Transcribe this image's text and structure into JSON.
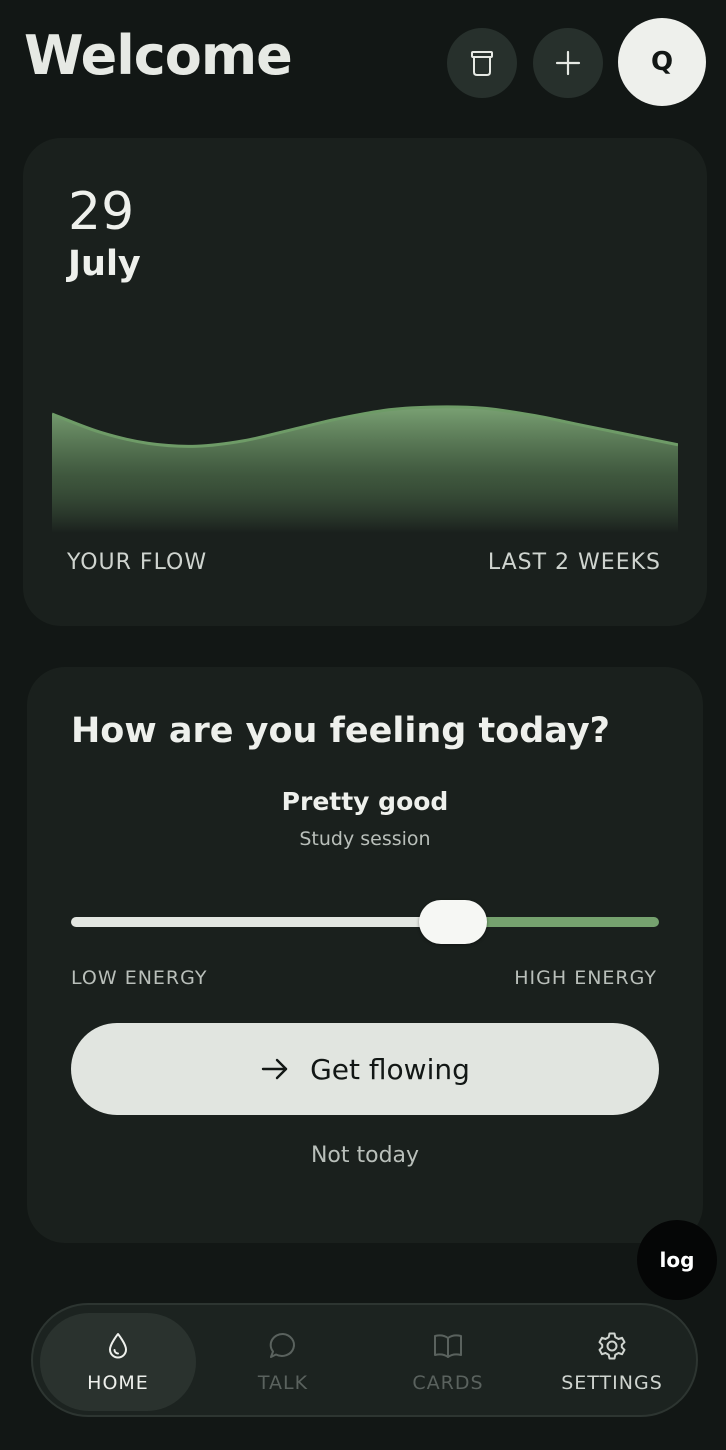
{
  "header": {
    "title": "Welcome",
    "avatar_initial": "Q",
    "icons": [
      "jar-icon",
      "plus-icon"
    ]
  },
  "flow_card": {
    "day": "29",
    "month": "July",
    "label_left": "YOUR FLOW",
    "label_right": "LAST 2 WEEKS"
  },
  "chart_data": {
    "type": "area",
    "x": [
      1,
      2,
      3,
      4,
      5,
      6,
      7,
      8,
      9,
      10,
      11,
      12,
      13,
      14
    ],
    "values": [
      0.85,
      0.72,
      0.64,
      0.62,
      0.66,
      0.74,
      0.82,
      0.88,
      0.9,
      0.89,
      0.84,
      0.77,
      0.7,
      0.63
    ],
    "ylim": [
      0,
      1
    ],
    "grid": false,
    "line_color": "#6e9b67",
    "fill_top_color": "#7fa878",
    "fill_bottom_color": "#1a201d"
  },
  "feeling_card": {
    "title": "How are you feeling today?",
    "mood": "Pretty good",
    "context": "Study session",
    "energy_level": 0.65,
    "low_label": "LOW ENERGY",
    "high_label": "HIGH ENERGY",
    "cta_label": "Get flowing",
    "dismiss_label": "Not today"
  },
  "log_button": {
    "label": "log"
  },
  "nav": {
    "items": [
      {
        "label": "HOME",
        "icon": "drop-icon",
        "active": true
      },
      {
        "label": "TALK",
        "icon": "chat-icon",
        "active": false
      },
      {
        "label": "CARDS",
        "icon": "book-icon",
        "active": false
      },
      {
        "label": "SETTINGS",
        "icon": "gear-icon",
        "active": false
      }
    ]
  },
  "colors": {
    "background": "#121715",
    "card": "#1a201d",
    "accent": "#76a26f",
    "text_primary": "#eef0ec",
    "text_secondary": "#b9bfba",
    "nav_inactive": "#5a625e"
  }
}
